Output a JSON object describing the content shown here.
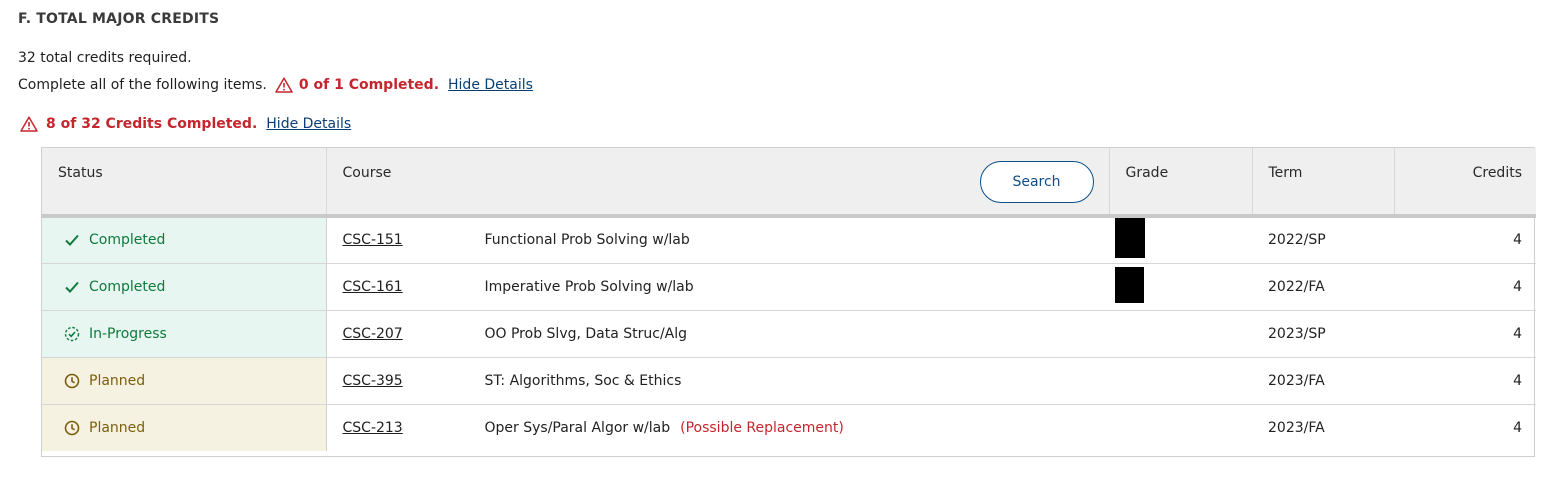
{
  "section": {
    "title": "F. TOTAL MAJOR CREDITS",
    "required_text": "32 total credits required.",
    "complete_text": "Complete all of the following items.",
    "items_status": "0 of 1 Completed.",
    "hide_details_1": "Hide Details",
    "credits_status": "8 of 32 Credits Completed.",
    "hide_details_2": "Hide Details"
  },
  "table": {
    "headers": {
      "status": "Status",
      "course": "Course",
      "search": "Search",
      "grade": "Grade",
      "term": "Term",
      "credits": "Credits"
    },
    "rows": [
      {
        "status": "Completed",
        "code": "CSC-151",
        "title": "Functional Prob Solving w/lab",
        "note": "",
        "term": "2022/SP",
        "credits": "4"
      },
      {
        "status": "Completed",
        "code": "CSC-161",
        "title": "Imperative Prob Solving w/lab",
        "note": "",
        "term": "2022/FA",
        "credits": "4"
      },
      {
        "status": "In-Progress",
        "code": "CSC-207",
        "title": "OO Prob Slvg, Data Struc/Alg",
        "note": "",
        "term": "2023/SP",
        "credits": "4"
      },
      {
        "status": "Planned",
        "code": "CSC-395",
        "title": "ST: Algorithms, Soc & Ethics",
        "note": "",
        "term": "2023/FA",
        "credits": "4"
      },
      {
        "status": "Planned",
        "code": "CSC-213",
        "title": "Oper Sys/Paral Algor w/lab",
        "note": "(Possible Replacement)",
        "term": "2023/FA",
        "credits": "4"
      }
    ]
  },
  "colors": {
    "error": "#c4262e",
    "completed": "#0e7a3c",
    "planned": "#7a5f0c",
    "link": "#0b3f73"
  }
}
